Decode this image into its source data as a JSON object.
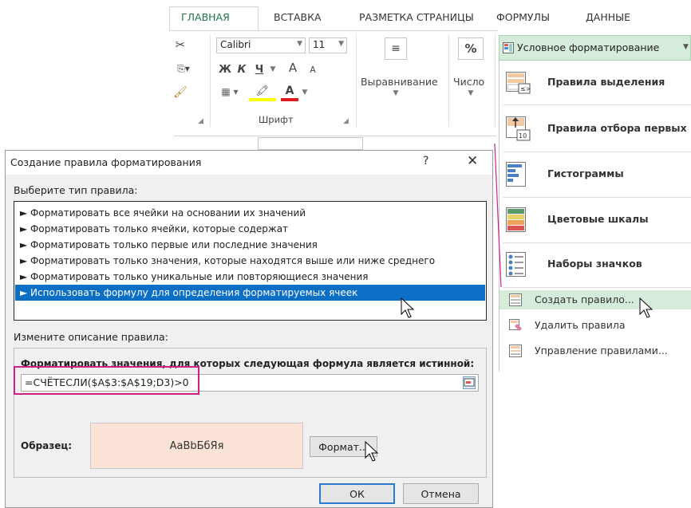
{
  "ribbon": {
    "tabs": [
      "ГЛАВНАЯ",
      "ВСТАВКА",
      "РАЗМЕТКА СТРАНИЦЫ",
      "ФОРМУЛЫ",
      "ДАННЫЕ"
    ],
    "font_name": "Calibri",
    "font_size": "11",
    "bold": "Ж",
    "italic": "К",
    "underline": "Ч",
    "grow_font": "A",
    "shrink_font": "A",
    "font_color_letter": "A",
    "font_group_label": "Шрифт",
    "alignment_label": "Выравнивание",
    "number_label": "Число",
    "percent": "%"
  },
  "cf_menu": {
    "button_label": "Условное форматирование",
    "items_big": [
      {
        "label": "Правила выделения",
        "icon": "highlight-rules-icon"
      },
      {
        "label": "Правила отбора первых",
        "icon": "top-rules-icon"
      },
      {
        "label": "Гистограммы",
        "icon": "data-bars-icon"
      },
      {
        "label": "Цветовые шкалы",
        "icon": "color-scales-icon"
      },
      {
        "label": "Наборы значков",
        "icon": "icon-sets-icon"
      }
    ],
    "top_icon_badge": "10",
    "items_small": [
      {
        "label": "Создать правило...",
        "icon": "new-rule-icon"
      },
      {
        "label": "Удалить правила",
        "icon": "clear-rules-icon"
      },
      {
        "label": "Управление правилами...",
        "icon": "manage-rules-icon"
      }
    ]
  },
  "dialog": {
    "title": "Создание правила форматирования",
    "help": "?",
    "close": "✕",
    "select_type_label": "Выберите тип правила:",
    "rule_types": [
      "Форматировать все ячейки на основании их значений",
      "Форматировать только ячейки, которые содержат",
      "Форматировать только первые или последние значения",
      "Форматировать только значения, которые находятся выше или ниже среднего",
      "Форматировать только уникальные или повторяющиеся значения",
      "Использовать формулу для определения форматируемых ячеек"
    ],
    "selected_rule_index": 5,
    "edit_desc_label": "Измените описание правила:",
    "formula_label": "Форматировать значения, для которых следующая формула является истинной:",
    "formula_value": "=СЧЁТЕСЛИ($A$3:$A$19;D3)>0",
    "preview_label": "Образец:",
    "preview_text": "АаВbБбЯя",
    "preview_fill": "#fbe3d7",
    "format_button": "Формат...",
    "ok_button": "ОК",
    "cancel_button": "Отмена"
  },
  "colors": {
    "accent_green": "#217346",
    "selection_blue": "#0b6fc6",
    "highlight_pink": "#d21f85",
    "menu_highlight": "#d4ecd9"
  }
}
